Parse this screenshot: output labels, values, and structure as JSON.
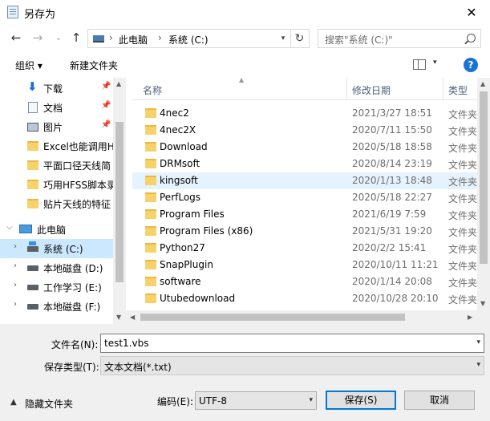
{
  "window": {
    "title": "另存为",
    "close_glyph": "✕"
  },
  "nav": {
    "back": "←",
    "forward": "→",
    "recent": "⌄",
    "up": "↑",
    "address_segments": [
      "此电脑",
      "系统 (C:)"
    ],
    "address_sep": "›",
    "search_placeholder": "搜索\"系统 (C:)\""
  },
  "toolbar": {
    "organize": "组织 ▾",
    "new_folder": "新建文件夹",
    "help": "?"
  },
  "sidebar": {
    "quick_access": [
      {
        "label": "下载",
        "icon": "download-icon",
        "pinned": true
      },
      {
        "label": "文档",
        "icon": "document-icon",
        "pinned": true
      },
      {
        "label": "图片",
        "icon": "pictures-icon",
        "pinned": true
      },
      {
        "label": "Excel也能调用H",
        "icon": "folder-icon"
      },
      {
        "label": "平面口径天线简",
        "icon": "folder-icon"
      },
      {
        "label": "巧用HFSS脚本录",
        "icon": "folder-icon"
      },
      {
        "label": "贴片天线的特征",
        "icon": "folder-icon"
      }
    ],
    "this_pc": "此电脑",
    "drives": [
      {
        "label": "系统 (C:)",
        "selected": true
      },
      {
        "label": "本地磁盘 (D:)"
      },
      {
        "label": "工作学习 (E:)"
      },
      {
        "label": "本地磁盘 (F:)"
      }
    ]
  },
  "columns": {
    "name": "名称",
    "date": "修改日期",
    "type": "类型"
  },
  "files": [
    {
      "name": "4nec2",
      "date": "2021/3/27 18:51",
      "type": "文件夹"
    },
    {
      "name": "4nec2X",
      "date": "2020/7/11 15:50",
      "type": "文件夹"
    },
    {
      "name": "Download",
      "date": "2020/5/18 18:58",
      "type": "文件夹"
    },
    {
      "name": "DRMsoft",
      "date": "2020/8/14 23:19",
      "type": "文件夹"
    },
    {
      "name": "kingsoft",
      "date": "2020/1/13 18:48",
      "type": "文件夹",
      "selected": true
    },
    {
      "name": "PerfLogs",
      "date": "2020/5/18 22:27",
      "type": "文件夹"
    },
    {
      "name": "Program Files",
      "date": "2021/6/19 7:59",
      "type": "文件夹"
    },
    {
      "name": "Program Files (x86)",
      "date": "2021/5/31 19:20",
      "type": "文件夹"
    },
    {
      "name": "Python27",
      "date": "2020/2/2 15:41",
      "type": "文件夹"
    },
    {
      "name": "SnapPlugin",
      "date": "2020/10/11 11:21",
      "type": "文件夹"
    },
    {
      "name": "software",
      "date": "2020/1/14 20:08",
      "type": "文件夹"
    },
    {
      "name": "Utubedownload",
      "date": "2020/10/28 20:10",
      "type": "文件夹"
    }
  ],
  "form": {
    "filename_label": "文件名(N):",
    "filename_value": "test1.vbs",
    "filetype_label": "保存类型(T):",
    "filetype_value": "文本文档(*.txt)",
    "encoding_label": "编码(E):",
    "encoding_value": "UTF-8",
    "hide_folders": "隐藏文件夹",
    "save": "保存(S)",
    "cancel": "取消"
  }
}
